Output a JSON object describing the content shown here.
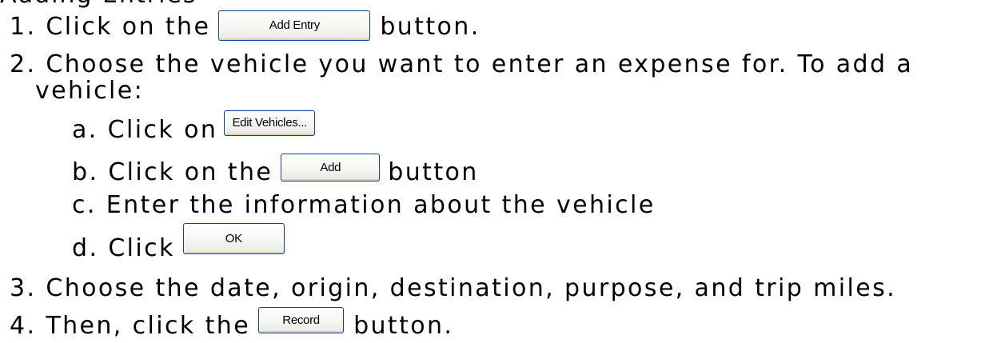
{
  "heading": "Adding Entries",
  "steps": {
    "s1": {
      "number": "1.",
      "before": "Click on the",
      "button": "Add Entry",
      "after": "button."
    },
    "s2": {
      "number": "2.",
      "line1": "Choose the vehicle you want to enter an expense for.  To add a",
      "line2": "vehicle:"
    },
    "s2a": {
      "letter": "a.",
      "before": "Click on",
      "button": "Edit Vehicles..."
    },
    "s2b": {
      "letter": "b.",
      "before": "Click on the",
      "button": "Add",
      "after": "button"
    },
    "s2c": {
      "letter": "c.",
      "text": "Enter the information about the vehicle"
    },
    "s2d": {
      "letter": "d.",
      "before": "Click",
      "button": "OK"
    },
    "s3": {
      "number": "3.",
      "text": "Choose the date, origin, destination, purpose, and trip miles."
    },
    "s4": {
      "number": "4.",
      "before": "Then, click the",
      "button": "Record",
      "after": "button."
    }
  }
}
